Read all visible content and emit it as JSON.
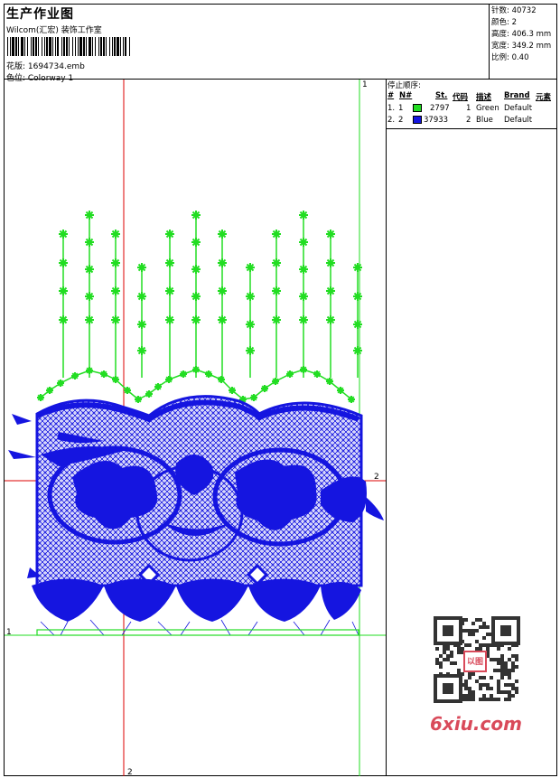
{
  "header": {
    "title": "生产作业图",
    "studio": "Wilcom(汇宏) 装饰工作室",
    "design_line": "花版: 1694734.emb",
    "colorway_line": "色位: Colorway 1"
  },
  "info": {
    "stitches": "针数: 40732",
    "colors": "颜色: 2",
    "height": "高度: 406.3 mm",
    "width": "宽度: 349.2 mm",
    "scale": "比例: 0.40"
  },
  "stop_sequence": {
    "title": "停止顺序:",
    "headers": {
      "num": "#",
      "needle": "N#",
      "stitches": "St.",
      "code": "代码",
      "desc": "描述",
      "brand": "Brand",
      "element": "元素"
    },
    "rows": [
      {
        "num": "1.",
        "needle": "1",
        "color": "#22dd22",
        "stitches": "2797",
        "code": "1",
        "desc": "Green",
        "brand": "Default"
      },
      {
        "num": "2.",
        "needle": "2",
        "color": "#1515e0",
        "stitches": "37933",
        "code": "2",
        "desc": "Blue",
        "brand": "Default"
      }
    ]
  },
  "markers": {
    "top_green": "1",
    "right_red": "2",
    "left_green": "1",
    "bottom_red": "2"
  },
  "watermark": {
    "site": "6xiu.com",
    "qr_badge": "以图"
  },
  "colors": {
    "green": "#22dd22",
    "blue": "#1515e0",
    "red": "#dd0000"
  }
}
